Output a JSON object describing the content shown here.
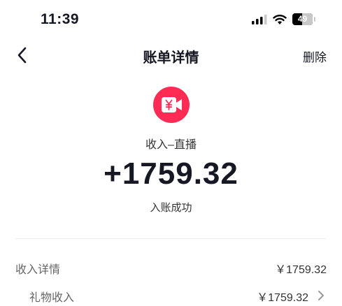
{
  "status_bar": {
    "time": "11:39",
    "battery": "49",
    "battery_fraction": 0.49
  },
  "nav": {
    "title": "账单详情",
    "delete_label": "删除"
  },
  "transaction": {
    "icon": "video-yuan-icon",
    "category": "收入–直播",
    "amount": "+1759.32",
    "status": "入账成功"
  },
  "details": {
    "income_label": "收入详情",
    "income_value": "￥1759.32",
    "gift_label": "礼物收入",
    "gift_value": "￥1759.32"
  },
  "colors": {
    "accent": "#fe2c55",
    "text_primary": "#161823",
    "text_secondary": "#666666"
  }
}
